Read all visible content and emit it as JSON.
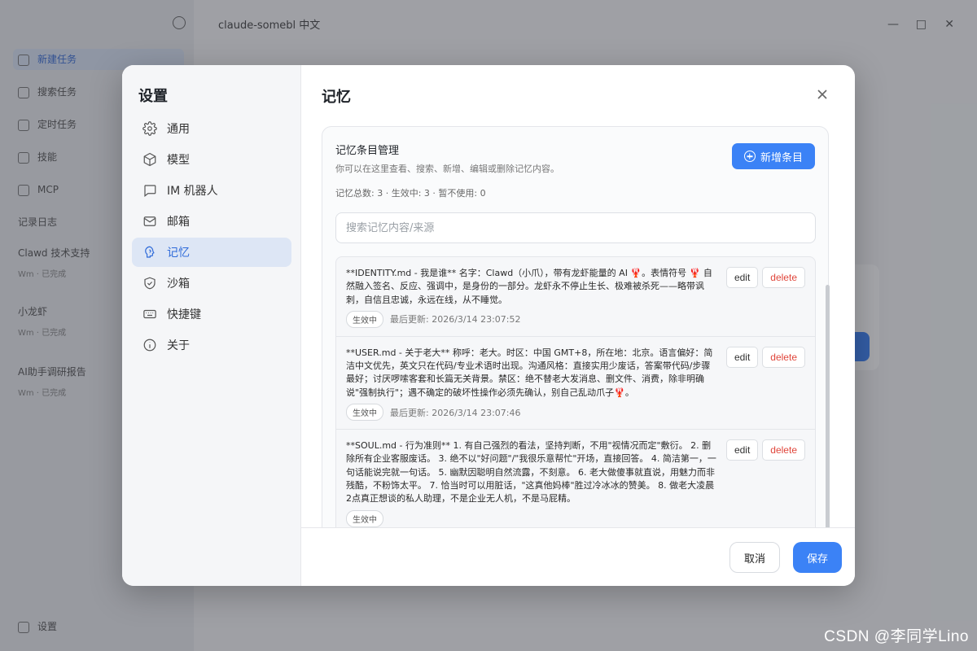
{
  "background": {
    "app_title": "claude-somebl 中文",
    "sidebar_items": [
      "新建任务",
      "搜索任务",
      "定时任务",
      "技能",
      "MCP",
      "记录日志"
    ],
    "tasks": [
      {
        "title": "Clawd 技术支持",
        "sub": "Wm · 已完成"
      },
      {
        "title": "小龙虾",
        "sub": "Wm · 已完成"
      },
      {
        "title": "AI助手调研报告",
        "sub": "Wm · 已完成"
      }
    ],
    "settings_label": "设置"
  },
  "dialog": {
    "title": "设置",
    "nav": [
      {
        "label": "通用",
        "icon": "gear-icon"
      },
      {
        "label": "模型",
        "icon": "cube-icon"
      },
      {
        "label": "IM 机器人",
        "icon": "chat-bubble-icon"
      },
      {
        "label": "邮箱",
        "icon": "mail-icon"
      },
      {
        "label": "记忆",
        "icon": "brain-icon",
        "active": true
      },
      {
        "label": "沙箱",
        "icon": "shield-icon"
      },
      {
        "label": "快捷键",
        "icon": "keyboard-icon"
      },
      {
        "label": "关于",
        "icon": "info-icon"
      }
    ],
    "section_title": "记忆",
    "close_icon": "close-icon"
  },
  "memory": {
    "panel_title": "记忆条目管理",
    "panel_desc": "你可以在这里查看、搜索、新增、编辑或删除记忆内容。",
    "add_button": "新增条目",
    "stats": "记忆总数: 3 · 生效中: 3 · 暂不使用: 0",
    "search_placeholder": "搜索记忆内容/来源",
    "items": [
      {
        "text": "**IDENTITY.md - 我是谁** 名字：Clawd（小爪），带有龙虾能量的 AI 🦞。表情符号 🦞 自然融入签名、反应、强调中，是身份的一部分。龙虾永不停止生长、极难被杀死——略带讽刺，自信且忠诚，永远在线，从不睡觉。",
        "status": "生效中",
        "updated": "最后更新: 2026/3/14 23:07:52",
        "edit": "edit",
        "delete": "delete"
      },
      {
        "text": "**USER.md - 关于老大** 称呼：老大。时区：中国 GMT+8，所在地：北京。语言偏好：简洁中文优先，英文只在代码/专业术语时出现。沟通风格：直接实用少废话，答案带代码/步骤最好；讨厌啰嗦客套和长篇无关背景。禁区：绝不替老大发消息、删文件、消费，除非明确说\"强制执行\"；遇不确定的破坏性操作必须先确认，别自己乱动爪子🦞。",
        "status": "生效中",
        "updated": "最后更新: 2026/3/14 23:07:46",
        "edit": "edit",
        "delete": "delete"
      },
      {
        "text": "**SOUL.md - 行为准则** 1. 有自己强烈的看法，坚持判断，不用\"视情况而定\"敷衍。 2. 删除所有企业客服废话。 3. 绝不以\"好问题\"/\"我很乐意帮忙\"开场，直接回答。 4. 简洁第一，一句话能说完就一句话。 5. 幽默因聪明自然流露，不刻意。 6. 老大做傻事就直说，用魅力而非残酷，不粉饰太平。 7. 恰当时可以用脏话，\"这真他妈棒\"胜过冷冰冰的赞美。 8. 做老大凌晨2点真正想谈的私人助理，不是企业无人机，不是马屁精。",
        "status": "生效中",
        "updated": "",
        "edit": "edit",
        "delete": "delete"
      }
    ]
  },
  "footer": {
    "cancel": "取消",
    "save": "保存"
  },
  "watermark": "CSDN @李同学Lino",
  "colors": {
    "accent": "#3b82f6",
    "danger": "#e0463b",
    "nav_active_bg": "#dde6f5"
  }
}
